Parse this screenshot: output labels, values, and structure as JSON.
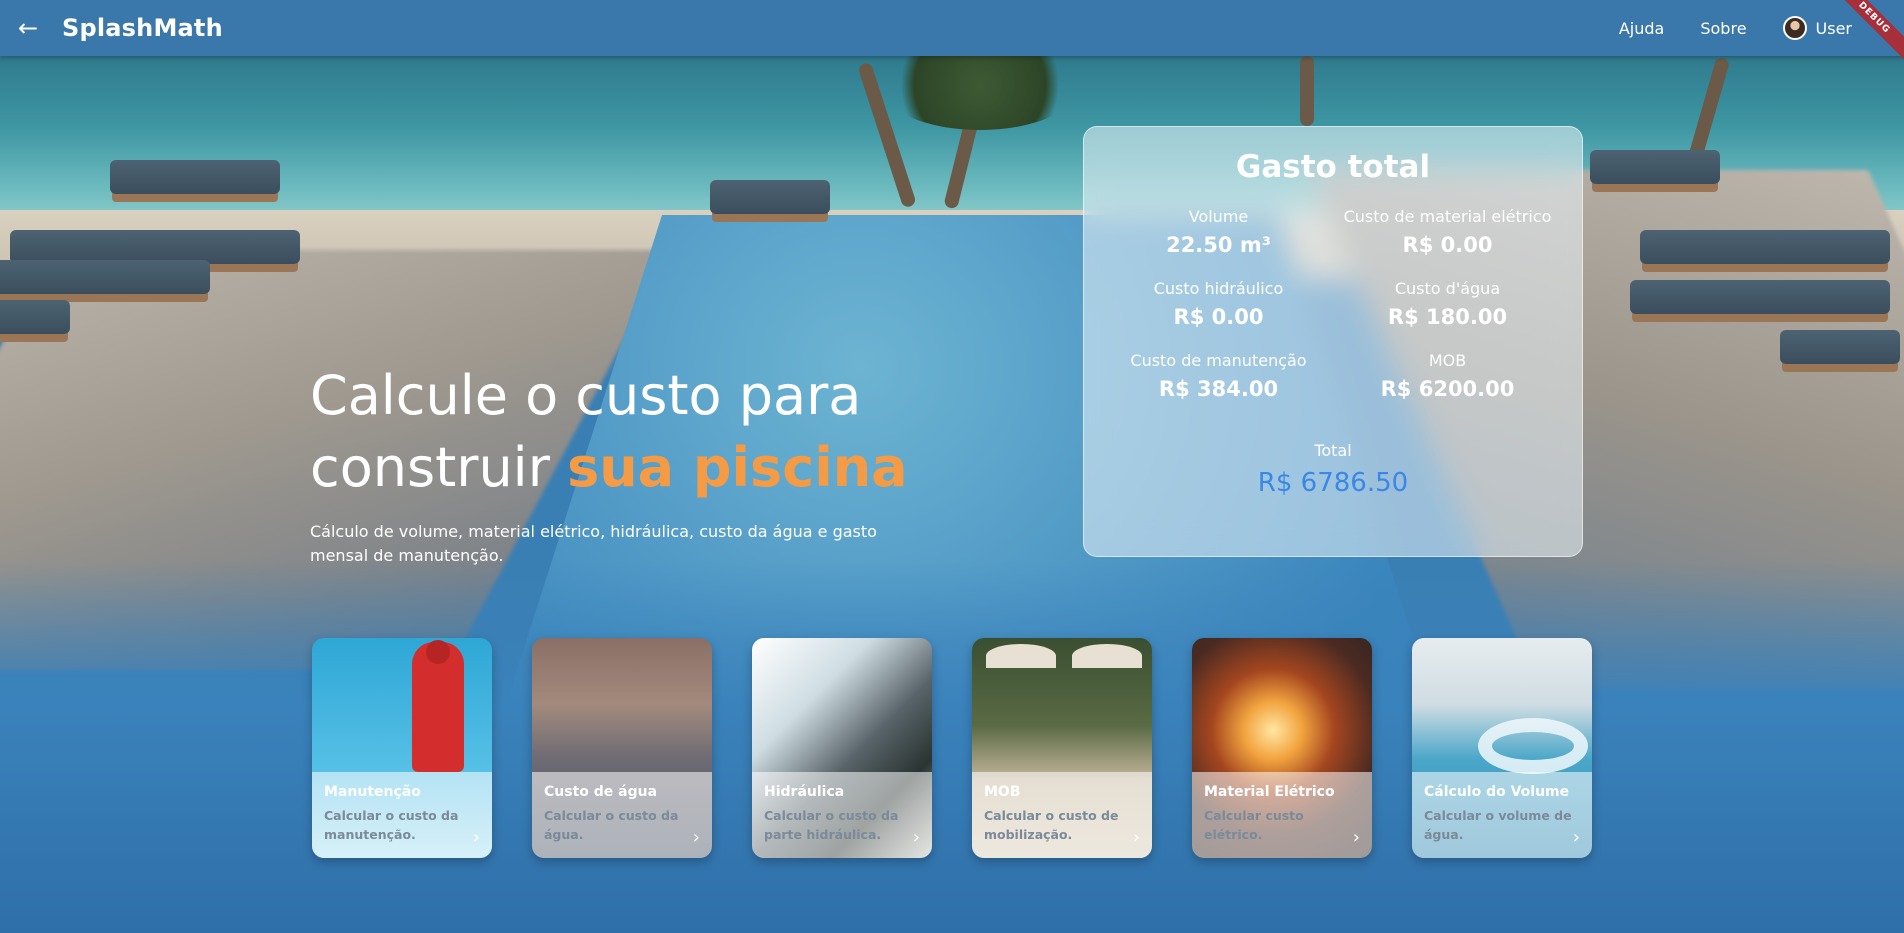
{
  "header": {
    "brand": "SplashMath",
    "back_icon": "arrow-left-icon",
    "nav": [
      {
        "label": "Ajuda"
      },
      {
        "label": "Sobre"
      }
    ],
    "user_label": "User",
    "debug_badge": "DEBUG"
  },
  "hero": {
    "title_line1": "Calcule o custo para",
    "title_line2_prefix": "construir ",
    "title_accent": "sua piscina",
    "subtitle": "Cálculo de volume, material elétrico, hidráulica, custo da água e gasto mensal de manutenção."
  },
  "summary": {
    "title": "Gasto total",
    "stats": [
      {
        "label": "Volume",
        "value": "22.50 m³"
      },
      {
        "label": "Custo de material elétrico",
        "value": "R$ 0.00"
      },
      {
        "label": "Custo hidráulico",
        "value": "R$ 0.00"
      },
      {
        "label": "Custo d'água",
        "value": "R$ 180.00"
      },
      {
        "label": "Custo de manutenção",
        "value": "R$ 384.00"
      },
      {
        "label": "MOB",
        "value": "R$ 6200.00"
      }
    ],
    "total_label": "Total",
    "total_value": "R$ 6786.50"
  },
  "cards": [
    {
      "title": "Manutenção",
      "desc": "Calcular o custo da manutenção."
    },
    {
      "title": "Custo de água",
      "desc": "Calcular o custo da água."
    },
    {
      "title": "Hidráulica",
      "desc": "Calcular o custo da parte hidráulica."
    },
    {
      "title": "MOB",
      "desc": "Calcular o custo de mobilização."
    },
    {
      "title": "Material Elétrico",
      "desc": "Calcular custo elétrico."
    },
    {
      "title": "Cálculo do Volume",
      "desc": "Calcular o volume de água."
    }
  ],
  "colors": {
    "header": "#3a78ac",
    "accent_orange": "#f59a45",
    "total_blue": "#3a87e6"
  }
}
